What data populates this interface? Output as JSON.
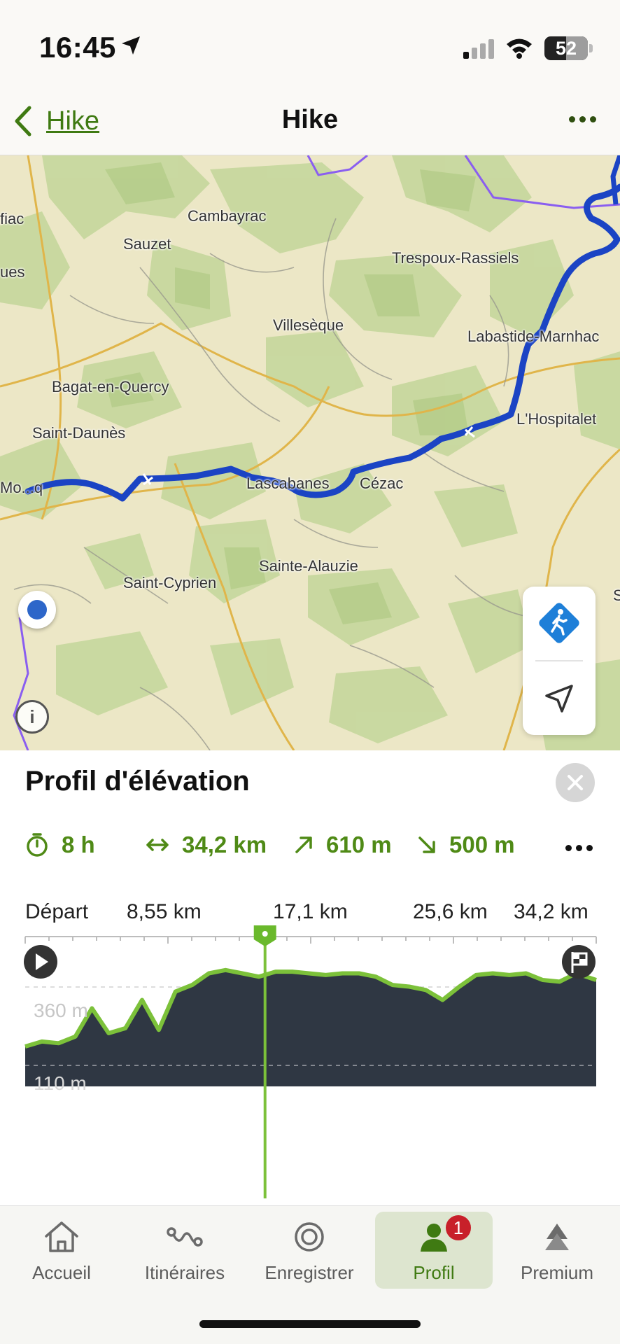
{
  "status": {
    "time": "16:45",
    "battery": "52"
  },
  "nav": {
    "back_label": "Hike",
    "title": "Hike"
  },
  "map": {
    "places": [
      {
        "name": "fiac"
      },
      {
        "name": "Cambayrac"
      },
      {
        "name": "Sauzet"
      },
      {
        "name": "Trespoux-Rassiels"
      },
      {
        "name": "ues"
      },
      {
        "name": "Villesèque"
      },
      {
        "name": "Labastide-Marnhac"
      },
      {
        "name": "Bagat-en-Quercy"
      },
      {
        "name": "L'Hospitalet"
      },
      {
        "name": "Saint-Daunès"
      },
      {
        "name": "Lascabanes"
      },
      {
        "name": "Cézac"
      },
      {
        "name": "Mo...q"
      },
      {
        "name": "Sainte-Alauzie"
      },
      {
        "name": "Saint-Cyprien"
      },
      {
        "name": "S"
      }
    ],
    "info_label": "i"
  },
  "profile": {
    "title": "Profil d'élévation",
    "stats": {
      "duration": "8 h",
      "distance": "34,2 km",
      "ascent": "610 m",
      "descent": "500 m"
    },
    "axis": [
      "Départ",
      "8,55 km",
      "17,1 km",
      "25,6 km",
      "34,2 km"
    ],
    "elev_high": "360 m",
    "elev_low": "110 m",
    "cursor_fraction": 0.42,
    "chart_data": {
      "type": "area",
      "x": [
        0,
        1,
        2,
        3,
        4,
        5,
        6,
        7,
        8,
        9,
        10,
        11,
        12,
        13,
        14,
        15,
        16,
        17,
        18,
        19,
        20,
        21,
        22,
        23,
        24,
        25,
        26,
        27,
        28,
        29,
        30,
        31,
        32,
        33,
        34.2
      ],
      "values": [
        120,
        135,
        130,
        150,
        235,
        160,
        175,
        260,
        170,
        285,
        305,
        340,
        350,
        340,
        330,
        345,
        345,
        340,
        335,
        340,
        340,
        330,
        305,
        300,
        290,
        260,
        300,
        335,
        340,
        335,
        340,
        320,
        315,
        340,
        320
      ],
      "ylim": [
        0,
        400
      ]
    }
  },
  "tabs": [
    {
      "label": "Accueil"
    },
    {
      "label": "Itinéraires"
    },
    {
      "label": "Enregistrer"
    },
    {
      "label": "Profil",
      "badge": "1"
    },
    {
      "label": "Premium"
    }
  ]
}
